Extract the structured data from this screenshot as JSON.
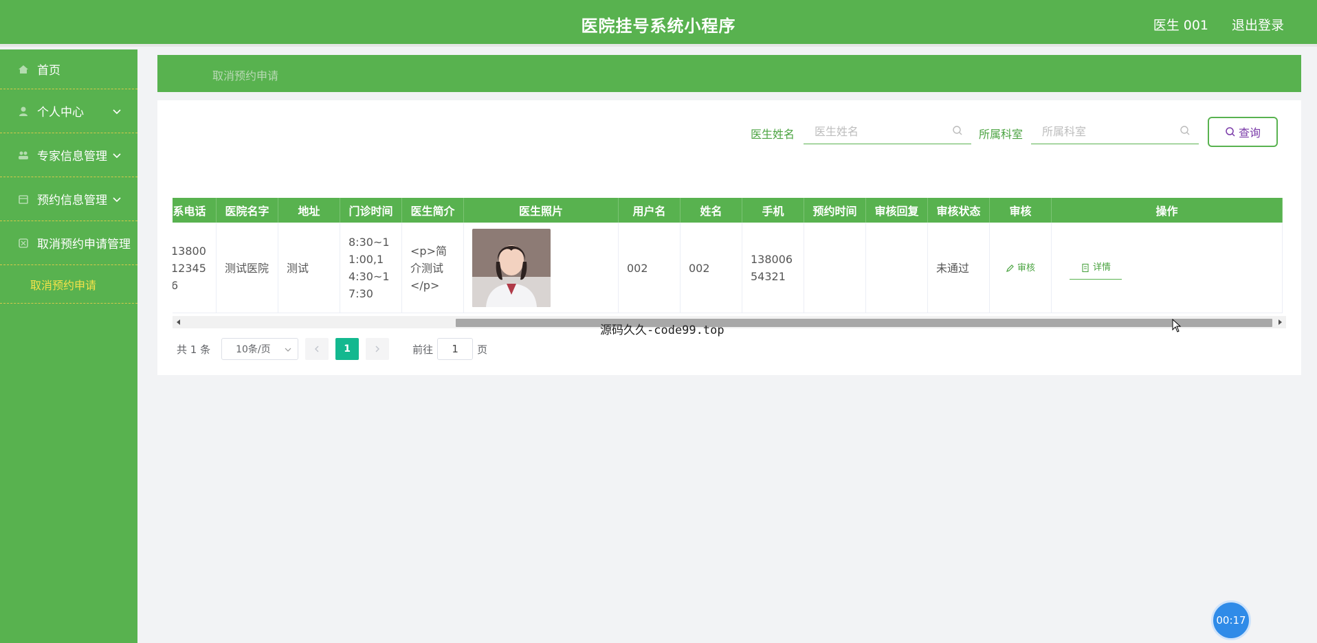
{
  "header": {
    "title": "医院挂号系统小程序",
    "user": "医生 001",
    "logout": "退出登录"
  },
  "sidebar": {
    "items": [
      {
        "label": "首页",
        "icon": "home-icon",
        "has_children": false
      },
      {
        "label": "个人中心",
        "icon": "user-icon",
        "has_children": true
      },
      {
        "label": "专家信息管理",
        "icon": "people-icon",
        "has_children": true
      },
      {
        "label": "预约信息管理",
        "icon": "calendar-icon",
        "has_children": true
      },
      {
        "label": "取消预约申请管理",
        "icon": "cancel-icon",
        "has_children": false
      }
    ],
    "sub_item": {
      "label": "取消预约申请"
    }
  },
  "breadcrumb": {
    "label": "取消预约申请"
  },
  "search": {
    "doctor_name_label": "医生姓名",
    "doctor_name_placeholder": "医生姓名",
    "department_label": "所属科室",
    "department_placeholder": "所属科室",
    "query_button": "查询"
  },
  "table": {
    "headers": [
      "联系电话",
      "医院名字",
      "地址",
      "门诊时间",
      "医生简介",
      "医生照片",
      "用户名",
      "姓名",
      "手机",
      "预约时间",
      "审核回复",
      "审核状态",
      "审核",
      "操作"
    ],
    "rows": [
      {
        "phone": "13800123456",
        "hospital": "测试医院",
        "address": "测试",
        "hours": "8:30~11:00,14:30~17:30",
        "intro": "<p>简介测试</p>",
        "username": "002",
        "name": "002",
        "mobile": "13800654321",
        "appt_time": "",
        "reply": "",
        "status": "未通过",
        "review_btn": "审核",
        "detail_btn": "详情"
      }
    ]
  },
  "pagination": {
    "total": "共 1 条",
    "page_size": "10条/页",
    "current": "1",
    "goto_prefix": "前往",
    "goto_value": "1",
    "goto_suffix": "页"
  },
  "overlay": {
    "caption": "源码久久-code99.top",
    "timer": "00:17"
  },
  "colors": {
    "accent": "#58b24f",
    "active_page": "#13b88f",
    "sidebar_sub": "#f5e24a"
  }
}
